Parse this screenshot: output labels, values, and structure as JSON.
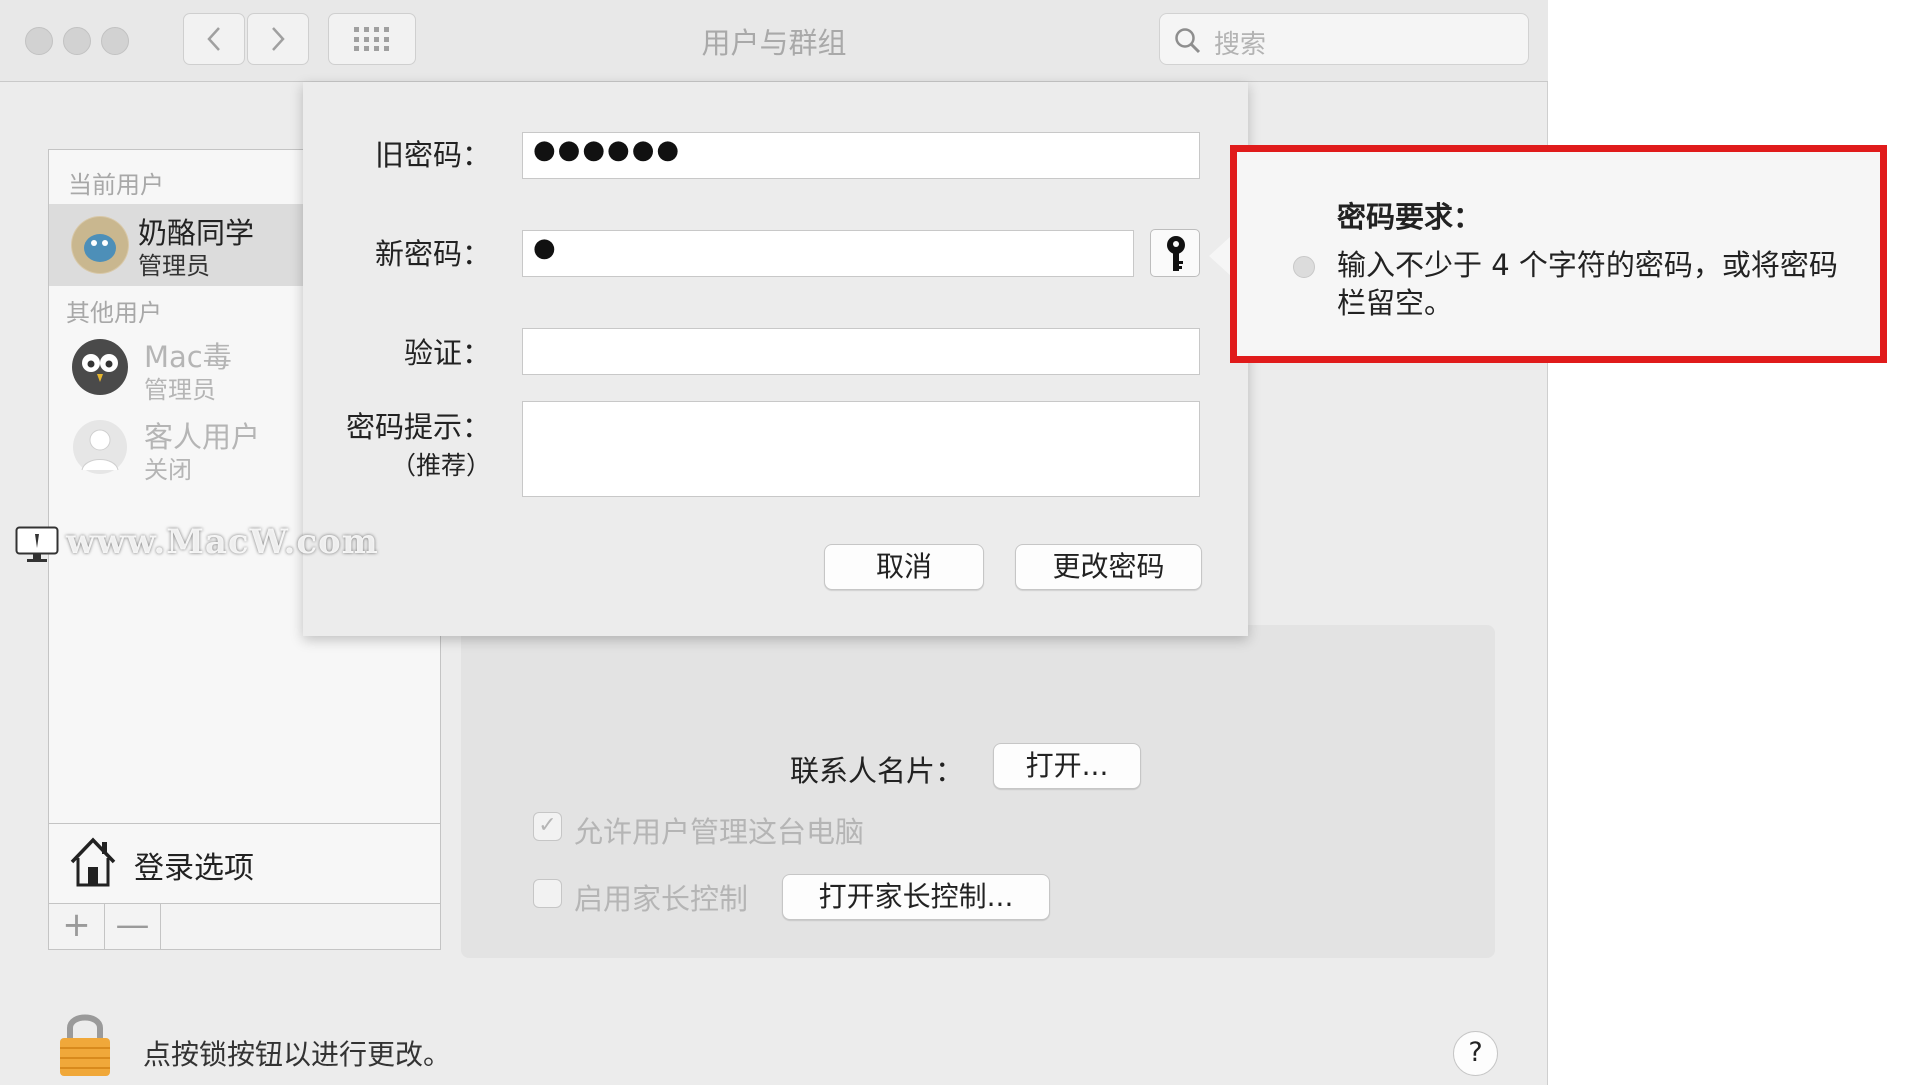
{
  "window": {
    "title": "用户与群组"
  },
  "search": {
    "placeholder": "搜索"
  },
  "sidebar": {
    "current_section": "当前用户",
    "current_user": {
      "name": "奶酪同学",
      "role": "管理员"
    },
    "other_section": "其他用户",
    "other_users": [
      {
        "name": "Mac毒",
        "role": "管理员"
      },
      {
        "name": "客人用户",
        "role": "关闭"
      }
    ],
    "login_options": "登录选项",
    "add": "+",
    "remove": "—"
  },
  "sheet": {
    "old_password_label": "旧密码：",
    "old_password_value": "●●●●●●",
    "new_password_label": "新密码：",
    "new_password_value": "●",
    "verify_label": "验证：",
    "hint_label": "密码提示：",
    "hint_sub": "（推荐）",
    "cancel": "取消",
    "change": "更改密码"
  },
  "popover": {
    "title": "密码要求：",
    "requirement": "输入不少于 4 个字符的密码，或将密码栏留空。"
  },
  "panel": {
    "contact_label": "联系人名片：",
    "contact_button": "打开...",
    "allow_admin": "允许用户管理这台电脑",
    "allow_admin_checked": true,
    "parental": "启用家长控制",
    "parental_checked": false,
    "parental_button": "打开家长控制..."
  },
  "footer": {
    "lock_text": "点按锁按钮以进行更改。",
    "help": "?"
  },
  "watermark": "www.MacW.com",
  "colors": {
    "highlight_border": "#e01b1b",
    "window_bg": "#ececec"
  }
}
